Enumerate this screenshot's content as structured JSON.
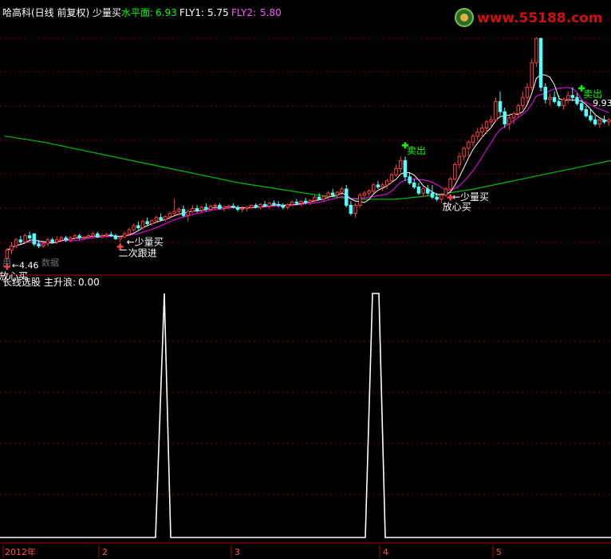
{
  "header": {
    "stock": "哈高科(日线 前复权) 少量买",
    "water_label": "水平面:",
    "water_value": "6.93",
    "fly1_label": "FLY1:",
    "fly1_value": "5.75",
    "fly2_label": "FLY2:",
    "fly2_value": "5.80",
    "watermark": "www.55188.com"
  },
  "indicator": {
    "name": "长线选股",
    "series_label": "主升浪:",
    "series_value": "0.00"
  },
  "overlay_text": "用",
  "overlay_text2": "数据",
  "time_axis": {
    "labels": [
      "2012年",
      "2",
      "3",
      "4",
      "5"
    ]
  },
  "colors": {
    "background": "#000000",
    "up_candle": "#ff3c3c",
    "down_candle": "#54ffff",
    "ma_short": "#ffffff",
    "ma_mid": "#ff00ff",
    "ma_long": "#00c000",
    "axis": "#b00000",
    "grid": "#800000",
    "header_white": "#ffffff",
    "header_green": "#00ff00",
    "header_magenta": "#ff55ff",
    "indicator_line": "#ffffff"
  },
  "chart_data": [
    {
      "type": "candlestick",
      "price_min_marker": 4.46,
      "price_max_marker": 9.93,
      "annotations": [
        {
          "text": "放心买",
          "color": "#ffffff",
          "index": 0
        },
        {
          "text": "←4.46",
          "color": "#ffffff",
          "index": 0
        },
        {
          "text": "←少量买",
          "color": "#ffffff",
          "index": 25
        },
        {
          "text": "二次跟进",
          "color": "#ffffff",
          "index": 25
        },
        {
          "text": "卖出",
          "color": "#00ff00",
          "index": 88
        },
        {
          "text": "←少量买",
          "color": "#ffffff",
          "index": 97
        },
        {
          "text": "放心买",
          "color": "#ffffff",
          "index": 98
        },
        {
          "text": "卖出",
          "color": "#00ff00",
          "index": 127
        },
        {
          "text": "9.93",
          "color": "#ffffff",
          "index": 127
        }
      ],
      "candles": [
        {
          "o": 4.5,
          "h": 4.75,
          "l": 4.45,
          "c": 4.7
        },
        {
          "o": 4.7,
          "h": 4.9,
          "l": 4.6,
          "c": 4.8
        },
        {
          "o": 4.8,
          "h": 5.0,
          "l": 4.75,
          "c": 4.95
        },
        {
          "o": 4.95,
          "h": 5.05,
          "l": 4.85,
          "c": 4.9
        },
        {
          "o": 4.9,
          "h": 5.1,
          "l": 4.85,
          "c": 5.05
        },
        {
          "o": 5.05,
          "h": 5.15,
          "l": 4.95,
          "c": 5.0
        },
        {
          "o": 5.1,
          "h": 5.1,
          "l": 4.8,
          "c": 4.85
        },
        {
          "o": 4.85,
          "h": 4.95,
          "l": 4.75,
          "c": 4.8
        },
        {
          "o": 4.8,
          "h": 4.9,
          "l": 4.75,
          "c": 4.85
        },
        {
          "o": 4.85,
          "h": 5.0,
          "l": 4.8,
          "c": 4.95
        },
        {
          "o": 4.95,
          "h": 5.0,
          "l": 4.85,
          "c": 4.9
        },
        {
          "o": 4.9,
          "h": 5.05,
          "l": 4.85,
          "c": 4.95
        },
        {
          "o": 4.95,
          "h": 5.05,
          "l": 4.9,
          "c": 5.0
        },
        {
          "o": 5.0,
          "h": 5.05,
          "l": 4.9,
          "c": 4.95
        },
        {
          "o": 4.95,
          "h": 5.05,
          "l": 4.9,
          "c": 5.0
        },
        {
          "o": 5.0,
          "h": 5.1,
          "l": 4.95,
          "c": 5.05
        },
        {
          "o": 5.05,
          "h": 5.1,
          "l": 4.95,
          "c": 5.0
        },
        {
          "o": 5.0,
          "h": 5.05,
          "l": 4.95,
          "c": 5.02
        },
        {
          "o": 5.02,
          "h": 5.1,
          "l": 4.98,
          "c": 5.05
        },
        {
          "o": 5.05,
          "h": 5.15,
          "l": 5.0,
          "c": 5.1
        },
        {
          "o": 5.1,
          "h": 5.15,
          "l": 5.0,
          "c": 5.02
        },
        {
          "o": 5.02,
          "h": 5.1,
          "l": 4.98,
          "c": 5.05
        },
        {
          "o": 5.05,
          "h": 5.12,
          "l": 5.0,
          "c": 5.08
        },
        {
          "o": 5.08,
          "h": 5.15,
          "l": 5.02,
          "c": 5.05
        },
        {
          "o": 5.05,
          "h": 5.1,
          "l": 4.95,
          "c": 4.98
        },
        {
          "o": 4.98,
          "h": 5.05,
          "l": 4.9,
          "c": 5.02
        },
        {
          "o": 5.02,
          "h": 5.15,
          "l": 5.0,
          "c": 5.1
        },
        {
          "o": 5.1,
          "h": 5.25,
          "l": 5.05,
          "c": 5.2
        },
        {
          "o": 5.2,
          "h": 5.35,
          "l": 5.15,
          "c": 5.3
        },
        {
          "o": 5.3,
          "h": 5.4,
          "l": 5.2,
          "c": 5.25
        },
        {
          "o": 5.25,
          "h": 5.45,
          "l": 5.2,
          "c": 5.4
        },
        {
          "o": 5.4,
          "h": 5.5,
          "l": 5.3,
          "c": 5.35
        },
        {
          "o": 5.35,
          "h": 5.45,
          "l": 5.3,
          "c": 5.42
        },
        {
          "o": 5.42,
          "h": 5.55,
          "l": 5.38,
          "c": 5.5
        },
        {
          "o": 5.5,
          "h": 5.6,
          "l": 5.4,
          "c": 5.45
        },
        {
          "o": 5.45,
          "h": 5.55,
          "l": 5.4,
          "c": 5.52
        },
        {
          "o": 5.52,
          "h": 5.65,
          "l": 5.45,
          "c": 5.6
        },
        {
          "o": 5.6,
          "h": 5.95,
          "l": 5.55,
          "c": 5.65
        },
        {
          "o": 5.65,
          "h": 5.75,
          "l": 5.55,
          "c": 5.7
        },
        {
          "o": 5.7,
          "h": 5.8,
          "l": 5.5,
          "c": 5.55
        },
        {
          "o": 5.55,
          "h": 5.7,
          "l": 5.4,
          "c": 5.65
        },
        {
          "o": 5.65,
          "h": 5.8,
          "l": 5.6,
          "c": 5.72
        },
        {
          "o": 5.72,
          "h": 5.8,
          "l": 5.62,
          "c": 5.68
        },
        {
          "o": 5.68,
          "h": 5.78,
          "l": 5.6,
          "c": 5.75
        },
        {
          "o": 5.75,
          "h": 5.85,
          "l": 5.65,
          "c": 5.7
        },
        {
          "o": 5.7,
          "h": 5.82,
          "l": 5.65,
          "c": 5.78
        },
        {
          "o": 5.78,
          "h": 5.85,
          "l": 5.7,
          "c": 5.8
        },
        {
          "o": 5.8,
          "h": 5.85,
          "l": 5.7,
          "c": 5.72
        },
        {
          "o": 5.72,
          "h": 5.8,
          "l": 5.65,
          "c": 5.75
        },
        {
          "o": 5.75,
          "h": 5.82,
          "l": 5.7,
          "c": 5.78
        },
        {
          "o": 5.78,
          "h": 5.85,
          "l": 5.72,
          "c": 5.75
        },
        {
          "o": 5.75,
          "h": 5.8,
          "l": 5.65,
          "c": 5.7
        },
        {
          "o": 5.7,
          "h": 5.78,
          "l": 5.62,
          "c": 5.72
        },
        {
          "o": 5.72,
          "h": 5.78,
          "l": 5.65,
          "c": 5.75
        },
        {
          "o": 5.75,
          "h": 5.82,
          "l": 5.7,
          "c": 5.8
        },
        {
          "o": 5.8,
          "h": 5.85,
          "l": 5.72,
          "c": 5.75
        },
        {
          "o": 5.75,
          "h": 5.85,
          "l": 5.7,
          "c": 5.82
        },
        {
          "o": 5.82,
          "h": 5.9,
          "l": 5.75,
          "c": 5.78
        },
        {
          "o": 5.78,
          "h": 5.88,
          "l": 5.72,
          "c": 5.85
        },
        {
          "o": 5.85,
          "h": 5.92,
          "l": 5.78,
          "c": 5.82
        },
        {
          "o": 5.82,
          "h": 5.9,
          "l": 5.75,
          "c": 5.8
        },
        {
          "o": 5.8,
          "h": 5.85,
          "l": 5.7,
          "c": 5.75
        },
        {
          "o": 5.75,
          "h": 5.85,
          "l": 5.7,
          "c": 5.82
        },
        {
          "o": 5.82,
          "h": 5.92,
          "l": 5.78,
          "c": 5.88
        },
        {
          "o": 5.88,
          "h": 5.95,
          "l": 5.8,
          "c": 5.85
        },
        {
          "o": 5.85,
          "h": 5.92,
          "l": 5.78,
          "c": 5.9
        },
        {
          "o": 5.9,
          "h": 5.98,
          "l": 5.82,
          "c": 5.88
        },
        {
          "o": 5.88,
          "h": 5.95,
          "l": 5.8,
          "c": 5.92
        },
        {
          "o": 5.92,
          "h": 6.05,
          "l": 5.88,
          "c": 6.0
        },
        {
          "o": 6.0,
          "h": 6.1,
          "l": 5.92,
          "c": 5.95
        },
        {
          "o": 5.95,
          "h": 6.05,
          "l": 5.9,
          "c": 6.02
        },
        {
          "o": 6.02,
          "h": 6.15,
          "l": 5.95,
          "c": 6.1
        },
        {
          "o": 6.1,
          "h": 6.2,
          "l": 6.0,
          "c": 6.05
        },
        {
          "o": 6.05,
          "h": 6.15,
          "l": 6.0,
          "c": 6.12
        },
        {
          "o": 6.12,
          "h": 6.25,
          "l": 6.05,
          "c": 6.2
        },
        {
          "o": 6.2,
          "h": 6.3,
          "l": 5.75,
          "c": 5.8
        },
        {
          "o": 5.8,
          "h": 5.9,
          "l": 5.55,
          "c": 5.6
        },
        {
          "o": 5.6,
          "h": 5.85,
          "l": 5.5,
          "c": 5.8
        },
        {
          "o": 5.8,
          "h": 6.1,
          "l": 5.75,
          "c": 6.05
        },
        {
          "o": 6.05,
          "h": 6.15,
          "l": 5.98,
          "c": 6.1
        },
        {
          "o": 6.1,
          "h": 6.2,
          "l": 6.02,
          "c": 6.15
        },
        {
          "o": 6.15,
          "h": 6.35,
          "l": 6.1,
          "c": 6.3
        },
        {
          "o": 6.3,
          "h": 6.4,
          "l": 6.2,
          "c": 6.25
        },
        {
          "o": 6.25,
          "h": 6.35,
          "l": 6.15,
          "c": 6.3
        },
        {
          "o": 6.3,
          "h": 6.45,
          "l": 6.2,
          "c": 6.4
        },
        {
          "o": 6.4,
          "h": 6.6,
          "l": 6.35,
          "c": 6.55
        },
        {
          "o": 6.55,
          "h": 6.8,
          "l": 6.5,
          "c": 6.7
        },
        {
          "o": 6.7,
          "h": 7.0,
          "l": 6.6,
          "c": 6.9
        },
        {
          "o": 6.9,
          "h": 7.0,
          "l": 6.4,
          "c": 6.5
        },
        {
          "o": 6.5,
          "h": 6.6,
          "l": 6.3,
          "c": 6.35
        },
        {
          "o": 6.35,
          "h": 6.45,
          "l": 6.2,
          "c": 6.25
        },
        {
          "o": 6.25,
          "h": 6.35,
          "l": 6.05,
          "c": 6.1
        },
        {
          "o": 6.1,
          "h": 6.25,
          "l": 6.0,
          "c": 6.2
        },
        {
          "o": 6.2,
          "h": 6.3,
          "l": 6.05,
          "c": 6.1
        },
        {
          "o": 6.1,
          "h": 6.3,
          "l": 5.95,
          "c": 6.0
        },
        {
          "o": 6.0,
          "h": 6.1,
          "l": 5.9,
          "c": 5.95
        },
        {
          "o": 5.95,
          "h": 6.1,
          "l": 5.85,
          "c": 6.05
        },
        {
          "o": 6.05,
          "h": 6.25,
          "l": 6.0,
          "c": 6.2
        },
        {
          "o": 6.2,
          "h": 6.5,
          "l": 6.15,
          "c": 6.45
        },
        {
          "o": 6.45,
          "h": 6.85,
          "l": 6.4,
          "c": 6.8
        },
        {
          "o": 6.8,
          "h": 7.1,
          "l": 6.7,
          "c": 7.0
        },
        {
          "o": 7.0,
          "h": 7.25,
          "l": 6.9,
          "c": 7.2
        },
        {
          "o": 7.2,
          "h": 7.4,
          "l": 7.0,
          "c": 7.35
        },
        {
          "o": 7.35,
          "h": 7.55,
          "l": 7.25,
          "c": 7.5
        },
        {
          "o": 7.5,
          "h": 7.7,
          "l": 7.4,
          "c": 7.6
        },
        {
          "o": 7.6,
          "h": 7.8,
          "l": 7.45,
          "c": 7.7
        },
        {
          "o": 7.7,
          "h": 7.9,
          "l": 7.55,
          "c": 7.85
        },
        {
          "o": 7.85,
          "h": 8.0,
          "l": 7.7,
          "c": 7.9
        },
        {
          "o": 7.9,
          "h": 8.45,
          "l": 7.85,
          "c": 8.35
        },
        {
          "o": 8.35,
          "h": 8.6,
          "l": 8.0,
          "c": 8.1
        },
        {
          "o": 8.1,
          "h": 8.2,
          "l": 7.7,
          "c": 7.8
        },
        {
          "o": 7.8,
          "h": 8.0,
          "l": 7.65,
          "c": 7.95
        },
        {
          "o": 7.95,
          "h": 8.1,
          "l": 7.8,
          "c": 8.05
        },
        {
          "o": 8.05,
          "h": 8.3,
          "l": 7.95,
          "c": 8.25
        },
        {
          "o": 8.25,
          "h": 8.6,
          "l": 8.15,
          "c": 8.45
        },
        {
          "o": 8.45,
          "h": 8.8,
          "l": 8.3,
          "c": 8.7
        },
        {
          "o": 8.7,
          "h": 9.4,
          "l": 8.6,
          "c": 9.3
        },
        {
          "o": 9.3,
          "h": 9.93,
          "l": 9.2,
          "c": 9.9
        },
        {
          "o": 9.9,
          "h": 9.92,
          "l": 8.6,
          "c": 8.7
        },
        {
          "o": 8.7,
          "h": 8.8,
          "l": 8.3,
          "c": 8.4
        },
        {
          "o": 8.4,
          "h": 8.55,
          "l": 8.25,
          "c": 8.45
        },
        {
          "o": 8.45,
          "h": 8.6,
          "l": 8.3,
          "c": 8.35
        },
        {
          "o": 8.35,
          "h": 8.5,
          "l": 8.2,
          "c": 8.25
        },
        {
          "o": 8.25,
          "h": 8.45,
          "l": 8.15,
          "c": 8.4
        },
        {
          "o": 8.4,
          "h": 8.6,
          "l": 8.3,
          "c": 8.5
        },
        {
          "o": 8.5,
          "h": 8.7,
          "l": 8.35,
          "c": 8.45
        },
        {
          "o": 8.45,
          "h": 8.55,
          "l": 8.25,
          "c": 8.3
        },
        {
          "o": 8.3,
          "h": 8.4,
          "l": 8.1,
          "c": 8.15
        },
        {
          "o": 8.15,
          "h": 8.25,
          "l": 7.95,
          "c": 8.0
        },
        {
          "o": 8.0,
          "h": 8.15,
          "l": 7.85,
          "c": 7.9
        },
        {
          "o": 7.9,
          "h": 8.0,
          "l": 7.75,
          "c": 7.8
        },
        {
          "o": 7.8,
          "h": 7.95,
          "l": 7.7,
          "c": 7.9
        },
        {
          "o": 7.9,
          "h": 8.0,
          "l": 7.8,
          "c": 7.85
        },
        {
          "o": 7.85,
          "h": 7.95,
          "l": 7.75,
          "c": 7.9
        }
      ],
      "ma_long_points": [
        [
          0,
          7.5
        ],
        [
          10,
          7.35
        ],
        [
          20,
          7.15
        ],
        [
          30,
          6.95
        ],
        [
          40,
          6.75
        ],
        [
          50,
          6.55
        ],
        [
          60,
          6.35
        ],
        [
          70,
          6.2
        ],
        [
          80,
          6.05
        ],
        [
          90,
          5.95
        ],
        [
          100,
          5.95
        ],
        [
          110,
          6.05
        ],
        [
          120,
          6.2
        ],
        [
          130,
          6.4
        ],
        [
          140,
          6.6
        ],
        [
          150,
          6.8
        ],
        [
          155,
          6.9
        ]
      ]
    },
    {
      "type": "line",
      "name": "主升浪",
      "ylim": [
        0,
        1
      ],
      "points": [
        [
          0,
          0
        ],
        [
          195,
          0
        ],
        [
          206,
          1
        ],
        [
          214,
          0
        ],
        [
          458,
          0
        ],
        [
          467,
          1
        ],
        [
          475,
          1
        ],
        [
          483,
          0
        ],
        [
          766,
          0
        ]
      ]
    }
  ]
}
